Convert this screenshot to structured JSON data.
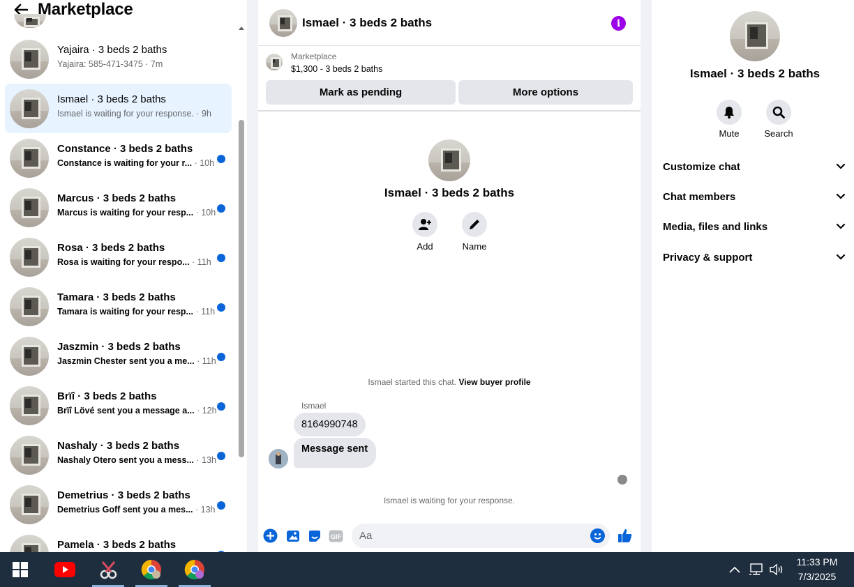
{
  "left": {
    "title": "Marketplace",
    "conversations": [
      {
        "name": "Yajaira · 3 beds 2 baths",
        "preview": "Yajaira: 585-471-3475",
        "time": "· 7m",
        "unread": false,
        "selected": false
      },
      {
        "name": "Ismael · 3 beds 2 baths",
        "preview": "Ismael is waiting for your response.",
        "time": "· 9h",
        "unread": false,
        "selected": true
      },
      {
        "name": "Constance · 3 beds 2 baths",
        "preview": "Constance is waiting for your r...",
        "time": "· 10h",
        "unread": true,
        "selected": false
      },
      {
        "name": "Marcus · 3 beds 2 baths",
        "preview": "Marcus is waiting for your resp...",
        "time": "· 10h",
        "unread": true,
        "selected": false
      },
      {
        "name": "Rosa · 3 beds 2 baths",
        "preview": "Rosa is waiting for your respo...",
        "time": "· 11h",
        "unread": true,
        "selected": false
      },
      {
        "name": "Tamara · 3 beds 2 baths",
        "preview": "Tamara is waiting for your resp...",
        "time": "· 11h",
        "unread": true,
        "selected": false
      },
      {
        "name": "Jaszmin · 3 beds 2 baths",
        "preview": "Jaszmin Chester sent you a me...",
        "time": "· 11h",
        "unread": true,
        "selected": false
      },
      {
        "name": "Brïî · 3 beds 2 baths",
        "preview": "Brïî Lövé sent you a message a...",
        "time": "· 12h",
        "unread": true,
        "selected": false
      },
      {
        "name": "Nashaly · 3 beds 2 baths",
        "preview": "Nashaly Otero sent you a mess...",
        "time": "· 13h",
        "unread": true,
        "selected": false
      },
      {
        "name": "Demetrius · 3 beds 2 baths",
        "preview": "Demetrius Goff sent you a mes...",
        "time": "· 13h",
        "unread": true,
        "selected": false
      },
      {
        "name": "Pamela · 3 beds 2 baths",
        "preview": "",
        "time": "",
        "unread": true,
        "selected": false
      }
    ]
  },
  "chat": {
    "title": "Ismael · 3 beds 2 baths",
    "listing": {
      "label": "Marketplace",
      "price": "$1,300 - 3 beds 2 baths"
    },
    "mark_pending": "Mark as pending",
    "more_options": "More options",
    "profile_name": "Ismael · 3 beds 2 baths",
    "add_label": "Add",
    "name_label": "Name",
    "started_text": "Ismael started this chat.",
    "view_profile": "View buyer profile",
    "sender": "Ismael",
    "message1": "8164990748",
    "message2": "Message sent",
    "waiting": "Ismael is waiting for your response.",
    "composer_placeholder": "Aa"
  },
  "details": {
    "name": "Ismael · 3 beds 2 baths",
    "mute": "Mute",
    "search": "Search",
    "rows": [
      "Customize chat",
      "Chat members",
      "Media, files and links",
      "Privacy & support"
    ]
  },
  "taskbar": {
    "time": "11:33 PM",
    "date": "7/3/2025"
  },
  "colors": {
    "accent": "#0a66d8",
    "info": "#9b00e8",
    "selected_bg": "#e7f3ff"
  }
}
